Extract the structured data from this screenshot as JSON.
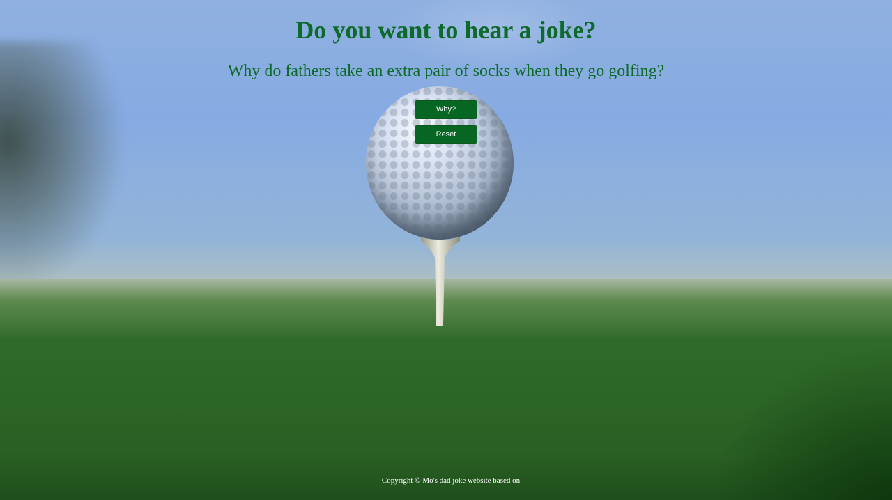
{
  "page": {
    "title": "Do you want to hear a joke?",
    "question": "Why do fathers take an extra pair of socks when they go golfing?"
  },
  "buttons": {
    "why_label": "Why?",
    "reset_label": "Reset"
  },
  "footer": {
    "text": "Copyright © Mo's dad joke website based on"
  },
  "colors": {
    "accent": "#0d6a2a",
    "button_bg": "#076722",
    "button_text": "#ffffff",
    "footer_text": "#ffffff"
  },
  "background": {
    "image": "golf-ball-on-tee-photo"
  }
}
